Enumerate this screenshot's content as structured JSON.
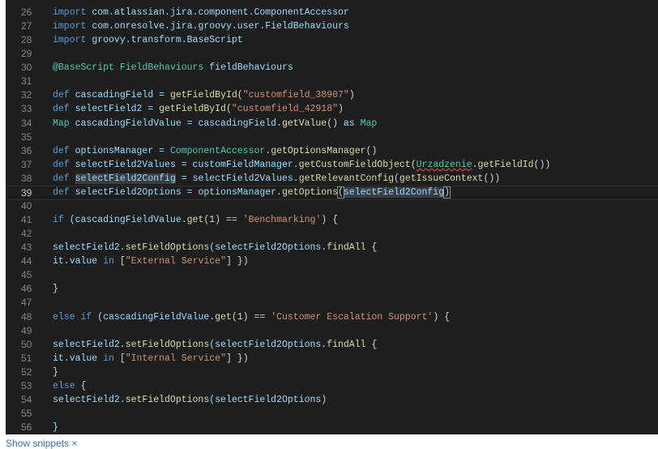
{
  "editor": {
    "current_line": 39,
    "lines": [
      {
        "n": "26",
        "tokens": [
          [
            "import",
            "k"
          ],
          [
            " com.atlassian.jira.component.ComponentAccessor",
            "i"
          ]
        ]
      },
      {
        "n": "27",
        "tokens": [
          [
            "import",
            "k"
          ],
          [
            " com.onresolve.jira.groovy.user.FieldBehaviours",
            "i"
          ]
        ]
      },
      {
        "n": "28",
        "tokens": [
          [
            "import",
            "k"
          ],
          [
            " groovy.transform.BaseScript",
            "i"
          ]
        ]
      },
      {
        "n": "29",
        "tokens": []
      },
      {
        "n": "30",
        "tokens": [
          [
            "@BaseScript",
            "t"
          ],
          [
            " "
          ],
          [
            "FieldBehaviours",
            "t"
          ],
          [
            " fieldBehaviours",
            "i"
          ]
        ]
      },
      {
        "n": "31",
        "tokens": []
      },
      {
        "n": "32",
        "tokens": [
          [
            "def",
            "k"
          ],
          [
            " cascadingField = ",
            "i"
          ],
          [
            "getFieldById",
            "f"
          ],
          [
            "(",
            "p"
          ],
          [
            "\"customfield_38907\"",
            "s"
          ],
          [
            ")",
            "p"
          ]
        ]
      },
      {
        "n": "33",
        "tokens": [
          [
            "def",
            "k"
          ],
          [
            " selectField2 = ",
            "i"
          ],
          [
            "getFieldById",
            "f"
          ],
          [
            "(",
            "p"
          ],
          [
            "\"customfield_42918\"",
            "s"
          ],
          [
            ")",
            "p"
          ]
        ]
      },
      {
        "n": "34",
        "tokens": [
          [
            "Map",
            "t"
          ],
          [
            " cascadingFieldValue = cascadingField.",
            "i"
          ],
          [
            "getValue",
            "f"
          ],
          [
            "() ",
            "p"
          ],
          [
            "as",
            "i"
          ],
          [
            " "
          ],
          [
            "Map",
            "t"
          ]
        ]
      },
      {
        "n": "35",
        "tokens": []
      },
      {
        "n": "36",
        "tokens": [
          [
            "def",
            "k"
          ],
          [
            " optionsManager = ",
            "i"
          ],
          [
            "ComponentAccessor",
            "t"
          ],
          [
            ".",
            "p"
          ],
          [
            "getOptionsManager",
            "f"
          ],
          [
            "()",
            "p"
          ]
        ]
      },
      {
        "n": "37",
        "tokens": [
          [
            "def",
            "k"
          ],
          [
            " selectField2Values = customFieldManager.",
            "i"
          ],
          [
            "getCustomFieldObject",
            "f"
          ],
          [
            "(",
            "p"
          ],
          [
            "Urzadzenie",
            "t sq"
          ],
          [
            ".",
            "p"
          ],
          [
            "getFieldId",
            "f"
          ],
          [
            "())",
            "p"
          ]
        ]
      },
      {
        "n": "38",
        "tokens": [
          [
            "def",
            "k"
          ],
          [
            " "
          ],
          [
            "selectField2Config",
            "i sel"
          ],
          [
            " = selectField2Values.",
            "i"
          ],
          [
            "getRelevantConfig",
            "f"
          ],
          [
            "(",
            "p"
          ],
          [
            "getIssueContext",
            "f"
          ],
          [
            "())",
            "p"
          ]
        ]
      },
      {
        "n": "39",
        "tokens": [
          [
            "def",
            "k"
          ],
          [
            " selectField2Options = optionsManager.",
            "i"
          ],
          [
            "getOptions",
            "f"
          ],
          [
            "(",
            "p br"
          ],
          [
            "selectField2Config",
            "i sel"
          ],
          [
            ")",
            "p br"
          ]
        ]
      },
      {
        "n": "40",
        "tokens": []
      },
      {
        "n": "41",
        "tokens": [
          [
            "if",
            "k"
          ],
          [
            " (cascadingFieldValue.",
            "i"
          ],
          [
            "get",
            "f"
          ],
          [
            "(1) == ",
            "p"
          ],
          [
            "'Benchmarking'",
            "s"
          ],
          [
            ") {",
            "p"
          ]
        ]
      },
      {
        "n": "42",
        "tokens": []
      },
      {
        "n": "43",
        "tokens": [
          [
            "selectField2.",
            "i"
          ],
          [
            "setFieldOptions",
            "f"
          ],
          [
            "(selectField2Options.",
            "i"
          ],
          [
            "findAll",
            "f"
          ],
          [
            " {",
            "p"
          ]
        ]
      },
      {
        "n": "44",
        "tokens": [
          [
            "it.value ",
            "i"
          ],
          [
            "in",
            "k"
          ],
          [
            " [",
            "p"
          ],
          [
            "\"External Service\"",
            "s"
          ],
          [
            "] })",
            "p"
          ]
        ]
      },
      {
        "n": "45",
        "tokens": []
      },
      {
        "n": "46",
        "tokens": [
          [
            "}",
            "p"
          ]
        ]
      },
      {
        "n": "47",
        "tokens": []
      },
      {
        "n": "48",
        "tokens": [
          [
            "else",
            "k"
          ],
          [
            " "
          ],
          [
            "if",
            "k"
          ],
          [
            " (cascadingFieldValue.",
            "i"
          ],
          [
            "get",
            "f"
          ],
          [
            "(1) == ",
            "p"
          ],
          [
            "'Customer Escalation Support'",
            "s"
          ],
          [
            ") {",
            "p"
          ]
        ]
      },
      {
        "n": "49",
        "tokens": []
      },
      {
        "n": "50",
        "tokens": [
          [
            "selectField2.",
            "i"
          ],
          [
            "setFieldOptions",
            "f"
          ],
          [
            "(selectField2Options.",
            "i"
          ],
          [
            "findAll",
            "f"
          ],
          [
            " {",
            "p"
          ]
        ]
      },
      {
        "n": "51",
        "tokens": [
          [
            "it.value ",
            "i"
          ],
          [
            "in",
            "k"
          ],
          [
            " [",
            "p"
          ],
          [
            "\"Internal Service\"",
            "s"
          ],
          [
            "] })",
            "p"
          ]
        ]
      },
      {
        "n": "52",
        "tokens": [
          [
            "}",
            "p"
          ]
        ]
      },
      {
        "n": "53",
        "tokens": [
          [
            "else",
            "k"
          ],
          [
            " {",
            "p"
          ]
        ]
      },
      {
        "n": "54",
        "tokens": [
          [
            "selectField2.",
            "i"
          ],
          [
            "setFieldOptions",
            "f"
          ],
          [
            "(selectField2Options)",
            "i"
          ]
        ]
      },
      {
        "n": "55",
        "tokens": []
      },
      {
        "n": "56",
        "tokens": [
          [
            "}",
            "i"
          ]
        ]
      }
    ]
  },
  "footer": {
    "show_snippets_label": "Show snippets",
    "close_icon": "×"
  },
  "colors": {
    "editor_bg": "#1e1e1e",
    "keyword": "#569cd6",
    "type": "#4ec9b0",
    "string": "#ce9178",
    "identifier": "#9cdcfe",
    "link": "#3572b0"
  }
}
